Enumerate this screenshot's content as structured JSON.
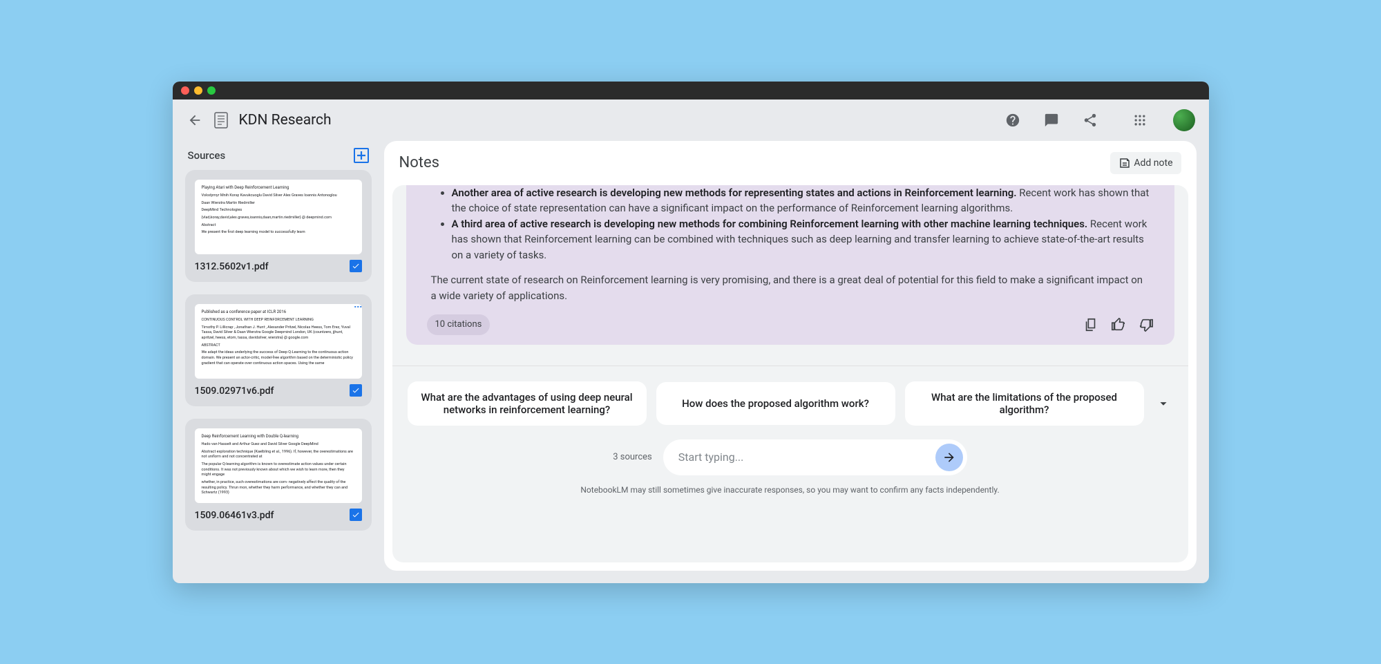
{
  "header": {
    "title": "KDN Research"
  },
  "sidebar": {
    "title": "Sources",
    "items": [
      {
        "filename": "1312.5602v1.pdf",
        "thumb_title": "Playing Atari with Deep Reinforcement Learning",
        "thumb_l1": "Volodymyr Mnih Koray Kavukcuoglu David Silver Alex Graves Ioannis Antonoglou",
        "thumb_l2": "Daan Wierstra Martin Riedmiller",
        "thumb_l3": "DeepMind Technologies",
        "thumb_l4": "{vlad,koray,david,alex.graves,ioannis,daan,martin.riedmiller} @ deepmind.com",
        "thumb_l5": "Abstract",
        "thumb_l6": "We present the first deep learning model to successfully learn",
        "checked": true
      },
      {
        "filename": "1509.02971v6.pdf",
        "thumb_title": "Published as a conference paper at ICLR 2016",
        "thumb_l1": "CONTINUOUS CONTROL WITH DEEP REINFORCEMENT LEARNING",
        "thumb_l2": "Timothy P. Lillicrap·, Jonathan J. Hunt·, Alexander Pritzel, Nicolas Heess, Tom Erez, Yuval Tassa, David Silver & Daan Wierstra Google Deepmind London, UK {countzero, jjhunt, apritzel, heess, etom, tassa, davidsilver, wierstra} @ google.com",
        "thumb_l3": "ABSTRACT",
        "thumb_l4": "We adapt the ideas underlying the success of Deep Q-Learning to the continuous action domain. We present an actor-critic, model-free algorithm based on the deterministic policy gradient that can operate over continuous action spaces. Using the same",
        "thumb_l5": "",
        "thumb_l6": "",
        "checked": true
      },
      {
        "filename": "1509.06461v3.pdf",
        "thumb_title": "Deep Reinforcement Learning with Double Q-learning",
        "thumb_l1": "Hado van Hasselt and Arthur Guez and David Silver Google DeepMind",
        "thumb_l2": "Abstract exploration technique (Kaelbling et al., 1996). If, however, the overestimations are not uniform and not concentrated at",
        "thumb_l3": "The popular Q-learning algorithm is known to overestimate action values under certain conditions. It was not previously known about which we wish to learn more, then they might engage",
        "thumb_l4": "whether, in practice, such overestimations are com- negatively affect the quality of the resulting policy. Thrun mon, whether they harm performance, and whether they can and Schwartz (1993)",
        "thumb_l5": "",
        "thumb_l6": "",
        "checked": true
      }
    ]
  },
  "main": {
    "notes_title": "Notes",
    "add_note_label": "Add note",
    "response": {
      "bullets": [
        {
          "bold": "Another area of active research is developing new methods for representing states and actions in Reinforcement learning.",
          "rest": " Recent work has shown that the choice of state representation can have a significant impact on the performance of Reinforcement learning algorithms."
        },
        {
          "bold": "A third area of active research is developing new methods for combining Reinforcement learning with other machine learning techniques.",
          "rest": " Recent work has shown that Reinforcement learning can be combined with techniques such as deep learning and transfer learning to achieve state-of-the-art results on a variety of tasks."
        }
      ],
      "closing": "The current state of research on Reinforcement learning is very promising, and there is a great deal of potential for this field to make a significant impact on a wide variety of applications.",
      "citations_label": "10 citations"
    },
    "suggestions": [
      "What are the advantages of using deep neural networks in reinforcement learning?",
      "How does the proposed algorithm work?",
      "What are the limitations of the proposed algorithm?"
    ],
    "input": {
      "source_count": "3 sources",
      "placeholder": "Start typing..."
    },
    "disclaimer": "NotebookLM may still sometimes give inaccurate responses, so you may want to confirm any facts independently."
  }
}
